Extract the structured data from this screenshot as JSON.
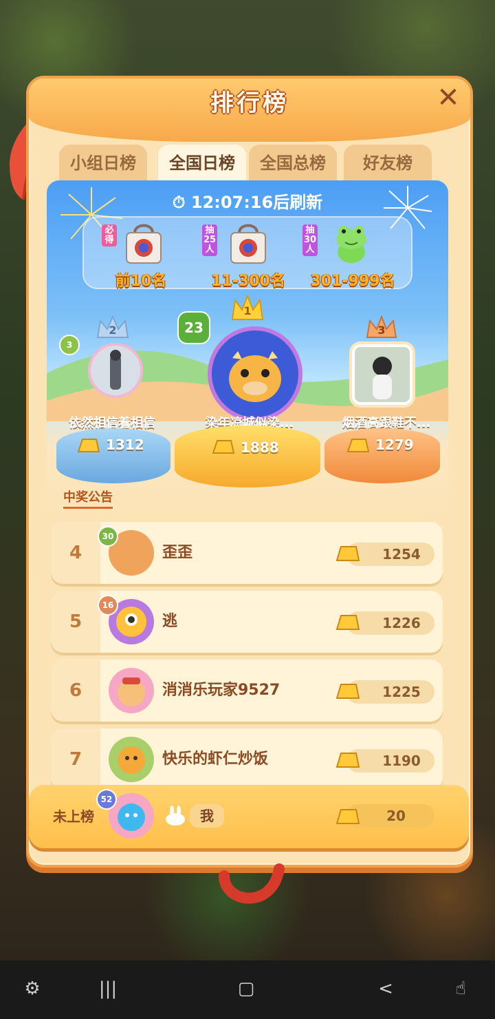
{
  "title": "排行榜",
  "tabs": [
    {
      "label": "小组日榜",
      "active": false
    },
    {
      "label": "全国日榜",
      "active": true
    },
    {
      "label": "全国总榜",
      "active": false
    },
    {
      "label": "好友榜",
      "active": false
    }
  ],
  "timer": "12:07:16后刷新",
  "rewards": [
    {
      "tag": "必得",
      "label": "前10名"
    },
    {
      "tag": "抽25人",
      "label": "11-300名"
    },
    {
      "tag": "抽30人",
      "label": "301-999名"
    }
  ],
  "podium": {
    "first": {
      "rank": "1",
      "level": "23",
      "name": "染年凉城似染...",
      "score": "1888"
    },
    "second": {
      "rank": "2",
      "level": "3",
      "name": "依然相信着相信",
      "score": "1312"
    },
    "third": {
      "rank": "3",
      "name": "烟酒高跟鞋不...",
      "score": "1279"
    }
  },
  "announcement": "中奖公告",
  "rows": [
    {
      "rank": "4",
      "level": "30",
      "name": "歪歪",
      "score": "1254"
    },
    {
      "rank": "5",
      "level": "16",
      "name": "逃",
      "score": "1226"
    },
    {
      "rank": "6",
      "name": "消消乐玩家9527",
      "score": "1225"
    },
    {
      "rank": "7",
      "name": "快乐的虾仁炒饭",
      "score": "1190"
    }
  ],
  "me": {
    "rank": "未上榜",
    "level": "52",
    "name": "我",
    "score": "20"
  },
  "colors": {
    "accent": "#f7a94b",
    "panel": "#fbe3b6",
    "sky": "#4c9ef5"
  }
}
